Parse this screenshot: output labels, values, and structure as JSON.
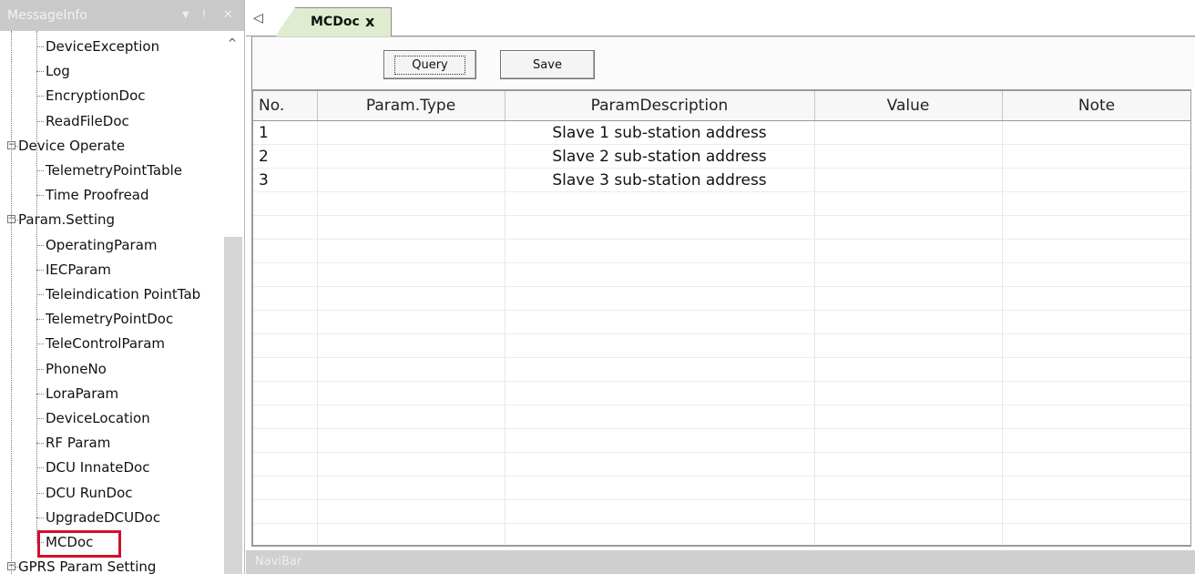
{
  "left_panel": {
    "title": "MessageInfo",
    "controls": {
      "dropdown": "▼",
      "pin": "ⵑ",
      "close": "✕"
    },
    "tree": [
      {
        "label": "DeviceException",
        "kind": "child"
      },
      {
        "label": "Log",
        "kind": "child"
      },
      {
        "label": "EncryptionDoc",
        "kind": "child"
      },
      {
        "label": "ReadFileDoc",
        "kind": "child"
      },
      {
        "label": "Device Operate",
        "kind": "group"
      },
      {
        "label": "TelemetryPointTable",
        "kind": "child"
      },
      {
        "label": "Time Proofread",
        "kind": "child"
      },
      {
        "label": "Param.Setting",
        "kind": "group"
      },
      {
        "label": "OperatingParam",
        "kind": "child"
      },
      {
        "label": "IECParam",
        "kind": "child"
      },
      {
        "label": "Teleindication PointTab",
        "kind": "child"
      },
      {
        "label": "TelemetryPointDoc",
        "kind": "child"
      },
      {
        "label": "TeleControlParam",
        "kind": "child"
      },
      {
        "label": "PhoneNo",
        "kind": "child"
      },
      {
        "label": "LoraParam",
        "kind": "child"
      },
      {
        "label": "DeviceLocation",
        "kind": "child"
      },
      {
        "label": "RF Param",
        "kind": "child"
      },
      {
        "label": "DCU InnateDoc",
        "kind": "child"
      },
      {
        "label": "DCU RunDoc",
        "kind": "child"
      },
      {
        "label": "UpgradeDCUDoc",
        "kind": "child"
      },
      {
        "label": "MCDoc",
        "kind": "child",
        "selected": true
      },
      {
        "label": "GPRS Param Setting",
        "kind": "group"
      }
    ]
  },
  "tabs": {
    "scroll_left": "◁",
    "active": {
      "label": "MCDoc",
      "close": "x"
    }
  },
  "toolbar": {
    "query_label": "Query",
    "save_label": "Save"
  },
  "grid": {
    "columns": [
      "No.",
      "Param.Type",
      "ParamDescription",
      "Value",
      "Note"
    ],
    "rows": [
      {
        "no": "1",
        "type": "",
        "desc": "Slave 1 sub-station address",
        "value": "",
        "note": ""
      },
      {
        "no": "2",
        "type": "",
        "desc": "Slave 2 sub-station address",
        "value": "",
        "note": ""
      },
      {
        "no": "3",
        "type": "",
        "desc": "Slave 3 sub-station address",
        "value": "",
        "note": ""
      }
    ]
  },
  "navibar": {
    "label": "NaviBar"
  },
  "colors": {
    "tab_bg": "#dfeccf",
    "panel_title_bg": "#c9c9c9",
    "highlight_border": "#d3102a"
  }
}
